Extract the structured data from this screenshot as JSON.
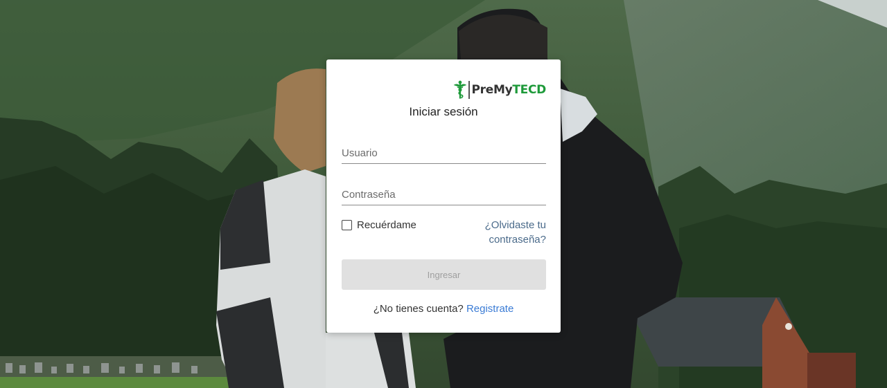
{
  "brand": {
    "logo_icon": "caduceus-icon",
    "name_prefix": "PreMy",
    "name_suffix": "TECD",
    "prefix_color": "#333333",
    "suffix_color": "#1e9a3a"
  },
  "login": {
    "title": "Iniciar sesión",
    "username_placeholder": "Usuario",
    "username_value": "",
    "password_placeholder": "Contraseña",
    "password_value": "",
    "remember_label": "Recuérdame",
    "remember_checked": false,
    "forgot_line1": "¿Olvidaste tu",
    "forgot_line2": "contraseña?",
    "submit_label": "Ingresar",
    "submit_disabled": true,
    "no_account_text": "¿No tienes cuenta?",
    "register_label": "Registrate"
  },
  "colors": {
    "link": "#3a7bd5",
    "button_disabled_bg": "#e0e0e0",
    "button_disabled_text": "#9e9e9e"
  }
}
